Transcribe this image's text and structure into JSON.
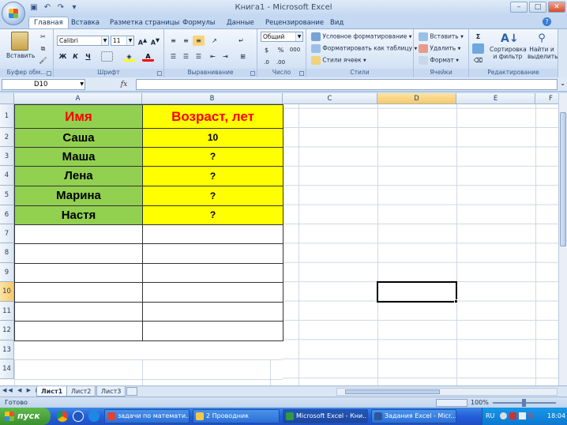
{
  "window": {
    "title": "Книга1 - Microsoft Excel"
  },
  "ribbon_tabs": [
    "Главная",
    "Вставка",
    "Разметка страницы",
    "Формулы",
    "Данные",
    "Рецензирование",
    "Вид"
  ],
  "ribbon": {
    "clipboard": {
      "label": "Буфер обм...",
      "paste": "Вставить"
    },
    "font": {
      "label": "Шрифт",
      "name": "Calibri",
      "size": "11",
      "bold": "Ж",
      "italic": "К",
      "underline": "Ч"
    },
    "alignment": {
      "label": "Выравнивание"
    },
    "number": {
      "label": "Число",
      "format": "Общий"
    },
    "styles": {
      "label": "Стили",
      "cond": "Условное форматирование",
      "table": "Форматировать как таблицу",
      "cell": "Стили ячеек"
    },
    "cells": {
      "label": "Ячейки",
      "insert": "Вставить",
      "delete": "Удалить",
      "format": "Формат"
    },
    "editing": {
      "label": "Редактирование",
      "sort_1": "Сортировка",
      "sort_2": "и фильтр",
      "find_1": "Найти и",
      "find_2": "выделить"
    }
  },
  "formula_bar": {
    "name_box": "D10",
    "fx": "fx",
    "value": ""
  },
  "columns": [
    "A",
    "B",
    "C",
    "D",
    "E",
    "F"
  ],
  "rows": [
    "1",
    "2",
    "3",
    "4",
    "5",
    "6",
    "7",
    "8",
    "9",
    "10",
    "11",
    "12",
    "13",
    "14"
  ],
  "table": {
    "header_name": "Имя",
    "header_age": "Возраст, лет",
    "names": [
      "Саша",
      "Маша",
      "Лена",
      "Марина",
      "Настя"
    ],
    "ages": [
      "10",
      "?",
      "?",
      "?",
      "?"
    ]
  },
  "sheet_tabs": [
    "Лист1",
    "Лист2",
    "Лист3"
  ],
  "status": {
    "ready": "Готово",
    "zoom": "100%"
  },
  "taskbar": {
    "start": "пуск",
    "items": [
      "задачи по математи...",
      "2 Проводник",
      "Microsoft Excel - Кни...",
      "Задания Excel - Micr..."
    ],
    "lang": "RU",
    "clock": "18:04"
  },
  "colors": {
    "green": "#92d050",
    "yellow": "#ffff00",
    "red": "#ff0000"
  }
}
